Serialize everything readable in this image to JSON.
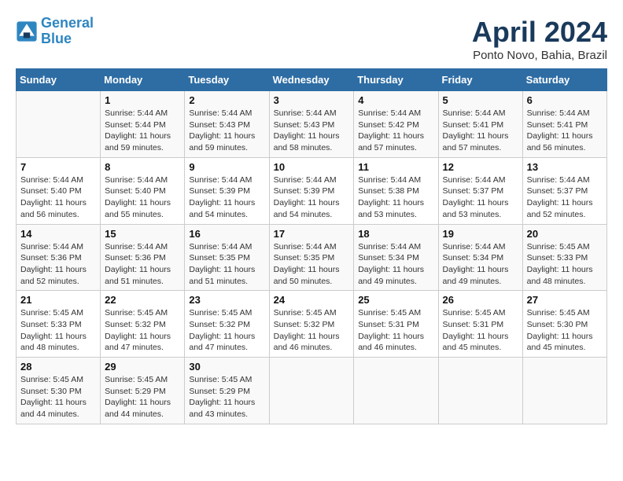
{
  "logo": {
    "line1": "General",
    "line2": "Blue"
  },
  "title": "April 2024",
  "subtitle": "Ponto Novo, Bahia, Brazil",
  "headers": [
    "Sunday",
    "Monday",
    "Tuesday",
    "Wednesday",
    "Thursday",
    "Friday",
    "Saturday"
  ],
  "weeks": [
    [
      {
        "day": "",
        "info": ""
      },
      {
        "day": "1",
        "info": "Sunrise: 5:44 AM\nSunset: 5:44 PM\nDaylight: 11 hours\nand 59 minutes."
      },
      {
        "day": "2",
        "info": "Sunrise: 5:44 AM\nSunset: 5:43 PM\nDaylight: 11 hours\nand 59 minutes."
      },
      {
        "day": "3",
        "info": "Sunrise: 5:44 AM\nSunset: 5:43 PM\nDaylight: 11 hours\nand 58 minutes."
      },
      {
        "day": "4",
        "info": "Sunrise: 5:44 AM\nSunset: 5:42 PM\nDaylight: 11 hours\nand 57 minutes."
      },
      {
        "day": "5",
        "info": "Sunrise: 5:44 AM\nSunset: 5:41 PM\nDaylight: 11 hours\nand 57 minutes."
      },
      {
        "day": "6",
        "info": "Sunrise: 5:44 AM\nSunset: 5:41 PM\nDaylight: 11 hours\nand 56 minutes."
      }
    ],
    [
      {
        "day": "7",
        "info": "Sunrise: 5:44 AM\nSunset: 5:40 PM\nDaylight: 11 hours\nand 56 minutes."
      },
      {
        "day": "8",
        "info": "Sunrise: 5:44 AM\nSunset: 5:40 PM\nDaylight: 11 hours\nand 55 minutes."
      },
      {
        "day": "9",
        "info": "Sunrise: 5:44 AM\nSunset: 5:39 PM\nDaylight: 11 hours\nand 54 minutes."
      },
      {
        "day": "10",
        "info": "Sunrise: 5:44 AM\nSunset: 5:39 PM\nDaylight: 11 hours\nand 54 minutes."
      },
      {
        "day": "11",
        "info": "Sunrise: 5:44 AM\nSunset: 5:38 PM\nDaylight: 11 hours\nand 53 minutes."
      },
      {
        "day": "12",
        "info": "Sunrise: 5:44 AM\nSunset: 5:37 PM\nDaylight: 11 hours\nand 53 minutes."
      },
      {
        "day": "13",
        "info": "Sunrise: 5:44 AM\nSunset: 5:37 PM\nDaylight: 11 hours\nand 52 minutes."
      }
    ],
    [
      {
        "day": "14",
        "info": "Sunrise: 5:44 AM\nSunset: 5:36 PM\nDaylight: 11 hours\nand 52 minutes."
      },
      {
        "day": "15",
        "info": "Sunrise: 5:44 AM\nSunset: 5:36 PM\nDaylight: 11 hours\nand 51 minutes."
      },
      {
        "day": "16",
        "info": "Sunrise: 5:44 AM\nSunset: 5:35 PM\nDaylight: 11 hours\nand 51 minutes."
      },
      {
        "day": "17",
        "info": "Sunrise: 5:44 AM\nSunset: 5:35 PM\nDaylight: 11 hours\nand 50 minutes."
      },
      {
        "day": "18",
        "info": "Sunrise: 5:44 AM\nSunset: 5:34 PM\nDaylight: 11 hours\nand 49 minutes."
      },
      {
        "day": "19",
        "info": "Sunrise: 5:44 AM\nSunset: 5:34 PM\nDaylight: 11 hours\nand 49 minutes."
      },
      {
        "day": "20",
        "info": "Sunrise: 5:45 AM\nSunset: 5:33 PM\nDaylight: 11 hours\nand 48 minutes."
      }
    ],
    [
      {
        "day": "21",
        "info": "Sunrise: 5:45 AM\nSunset: 5:33 PM\nDaylight: 11 hours\nand 48 minutes."
      },
      {
        "day": "22",
        "info": "Sunrise: 5:45 AM\nSunset: 5:32 PM\nDaylight: 11 hours\nand 47 minutes."
      },
      {
        "day": "23",
        "info": "Sunrise: 5:45 AM\nSunset: 5:32 PM\nDaylight: 11 hours\nand 47 minutes."
      },
      {
        "day": "24",
        "info": "Sunrise: 5:45 AM\nSunset: 5:32 PM\nDaylight: 11 hours\nand 46 minutes."
      },
      {
        "day": "25",
        "info": "Sunrise: 5:45 AM\nSunset: 5:31 PM\nDaylight: 11 hours\nand 46 minutes."
      },
      {
        "day": "26",
        "info": "Sunrise: 5:45 AM\nSunset: 5:31 PM\nDaylight: 11 hours\nand 45 minutes."
      },
      {
        "day": "27",
        "info": "Sunrise: 5:45 AM\nSunset: 5:30 PM\nDaylight: 11 hours\nand 45 minutes."
      }
    ],
    [
      {
        "day": "28",
        "info": "Sunrise: 5:45 AM\nSunset: 5:30 PM\nDaylight: 11 hours\nand 44 minutes."
      },
      {
        "day": "29",
        "info": "Sunrise: 5:45 AM\nSunset: 5:29 PM\nDaylight: 11 hours\nand 44 minutes."
      },
      {
        "day": "30",
        "info": "Sunrise: 5:45 AM\nSunset: 5:29 PM\nDaylight: 11 hours\nand 43 minutes."
      },
      {
        "day": "",
        "info": ""
      },
      {
        "day": "",
        "info": ""
      },
      {
        "day": "",
        "info": ""
      },
      {
        "day": "",
        "info": ""
      }
    ]
  ]
}
